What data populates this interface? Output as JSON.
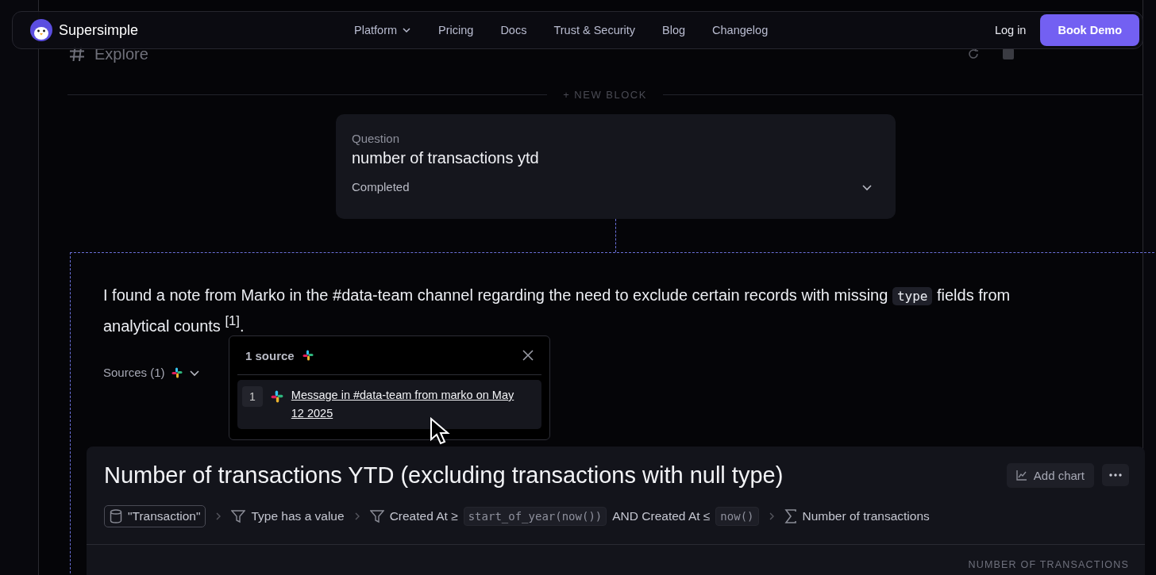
{
  "nav": {
    "brand": "Supersimple",
    "links": [
      {
        "label": "Platform",
        "has_menu": true
      },
      {
        "label": "Pricing",
        "has_menu": false
      },
      {
        "label": "Docs",
        "has_menu": false
      },
      {
        "label": "Trust & Security",
        "has_menu": false
      },
      {
        "label": "Blog",
        "has_menu": false
      },
      {
        "label": "Changelog",
        "has_menu": false
      }
    ],
    "login": "Log in",
    "cta": "Book Demo"
  },
  "page_header": {
    "title": "Explore"
  },
  "new_block": "+ NEW BLOCK",
  "question": {
    "label": "Question",
    "text": "number of transactions ytd",
    "status": "Completed",
    "expanded": false
  },
  "answer": {
    "text_before": "I found a note from Marko in the #data-team channel regarding the need to exclude certain records with missing",
    "code": "type",
    "text_after": "fields from analytical counts $^{[1]}$.",
    "sources_label": "Sources (1)"
  },
  "sources_popover": {
    "title": "1 source",
    "items": [
      {
        "number": "1",
        "link": "Message in #data-team from marko on May 12 2025"
      }
    ]
  },
  "result": {
    "title": "Number of transactions YTD (excluding transactions with null type)",
    "add_chart": "Add chart",
    "steps": [
      {
        "kind": "table",
        "parts": [
          {
            "kind": "text",
            "text": "\"Transaction\""
          }
        ]
      },
      {
        "kind": "filter",
        "parts": [
          {
            "kind": "text",
            "text": "Type has a value"
          }
        ]
      },
      {
        "kind": "filter",
        "parts": [
          {
            "kind": "text",
            "text": "Created At ≥"
          },
          {
            "kind": "code",
            "text": "start_of_year(now())"
          },
          {
            "kind": "text",
            "text": "AND Created At ≤"
          },
          {
            "kind": "code",
            "text": "now()"
          }
        ]
      },
      {
        "kind": "aggregate",
        "parts": [
          {
            "kind": "text",
            "text": "Number of transactions"
          }
        ]
      }
    ],
    "column_header": "NUMBER OF TRANSACTIONS"
  }
}
